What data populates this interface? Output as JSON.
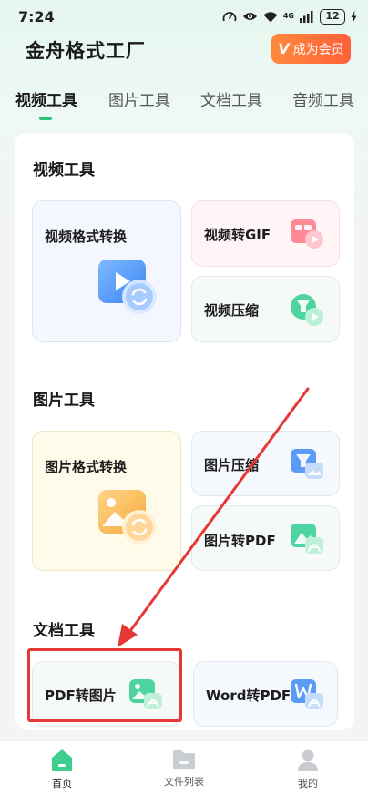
{
  "status_bar": {
    "time": "7:24",
    "network": "4G",
    "battery": "12"
  },
  "header": {
    "title": "金舟格式工厂",
    "member_label": "成为会员",
    "member_mark": "V"
  },
  "tabs": [
    {
      "label": "视频工具",
      "active": true
    },
    {
      "label": "图片工具",
      "active": false
    },
    {
      "label": "文档工具",
      "active": false
    },
    {
      "label": "音频工具",
      "active": false
    }
  ],
  "sections": {
    "video": {
      "title": "视频工具",
      "tools": {
        "format_convert": "视频格式转换",
        "to_gif": "视频转GIF",
        "compress": "视频压缩"
      }
    },
    "image": {
      "title": "图片工具",
      "tools": {
        "format_convert": "图片格式转换",
        "compress": "图片压缩",
        "to_pdf": "图片转PDF"
      }
    },
    "document": {
      "title": "文档工具",
      "tools": {
        "pdf_to_image": "PDF转图片",
        "word_to_pdf": "Word转PDF"
      }
    }
  },
  "bottom_nav": [
    {
      "label": "首页",
      "icon": "home-icon",
      "active": true
    },
    {
      "label": "文件列表",
      "icon": "folder-icon",
      "active": false
    },
    {
      "label": "我的",
      "icon": "user-icon",
      "active": false
    }
  ],
  "colors": {
    "accent": "#2cc27e",
    "member": "#ff6a3a",
    "annotation": "#e53935"
  }
}
